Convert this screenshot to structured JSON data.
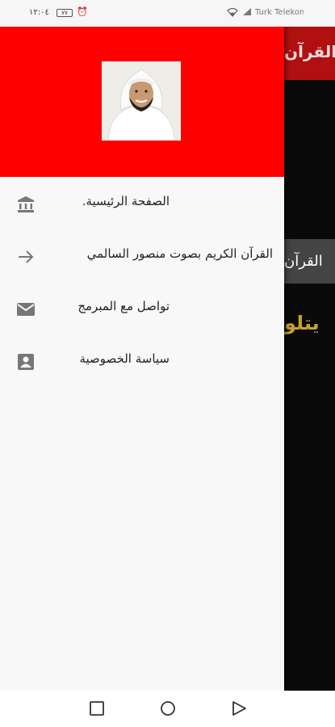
{
  "status_bar": {
    "time": "١٢:٠٤",
    "battery": "٧٧",
    "carrier": "Turk Telekom"
  },
  "app": {
    "toolbar_title": "القرآن",
    "card_text": "القرآن",
    "subtitle": "يتلو",
    "toolbar_color": "#b01010",
    "subtitle_color": "#c7a12a"
  },
  "drawer": {
    "header_color": "#ff0000",
    "avatar_alt": "avatar",
    "items": [
      {
        "label": "الصفحة الرئيسية.",
        "icon": "bank-icon"
      },
      {
        "label": "القرآن الكريم بصوت منصور السالمي",
        "icon": "arrow-right-icon"
      },
      {
        "label": "تواصل مع المبرمج",
        "icon": "mail-icon"
      },
      {
        "label": "سياسة الخصوصية",
        "icon": "contact-card-icon"
      }
    ]
  },
  "nav_bar": {
    "buttons": [
      "recents-square-icon",
      "home-circle-icon",
      "back-triangle-icon"
    ]
  }
}
